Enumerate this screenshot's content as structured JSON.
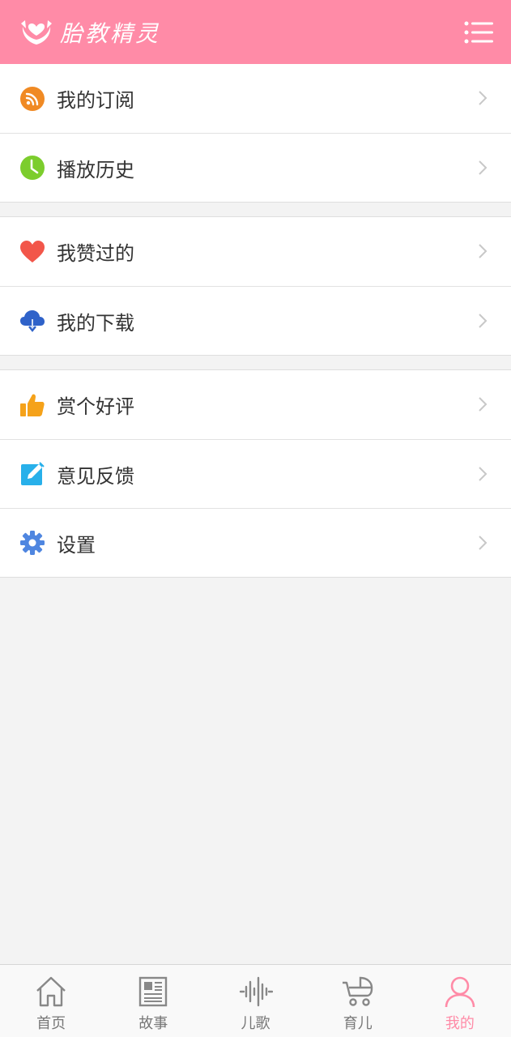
{
  "header": {
    "title": "胎教精灵",
    "logo_icon": "hands-heart-icon",
    "menu_icon": "list-menu-icon"
  },
  "groups": [
    {
      "items": [
        {
          "label": "我的订阅",
          "icon": "rss-icon",
          "color": "#f08a24"
        },
        {
          "label": "播放历史",
          "icon": "clock-icon",
          "color": "#7ccd2d"
        }
      ]
    },
    {
      "items": [
        {
          "label": "我赞过的",
          "icon": "heart-icon",
          "color": "#f2564a"
        },
        {
          "label": "我的下载",
          "icon": "cloud-download-icon",
          "color": "#2f62c9"
        }
      ]
    },
    {
      "items": [
        {
          "label": "赏个好评",
          "icon": "thumbs-up-icon",
          "color": "#f5a21a"
        },
        {
          "label": "意见反馈",
          "icon": "edit-icon",
          "color": "#28b0ea"
        },
        {
          "label": "设置",
          "icon": "gear-icon",
          "color": "#4f86e0"
        }
      ]
    }
  ],
  "tabbar": {
    "tabs": [
      {
        "label": "首页",
        "icon": "home-icon"
      },
      {
        "label": "故事",
        "icon": "newspaper-icon"
      },
      {
        "label": "儿歌",
        "icon": "sound-wave-icon"
      },
      {
        "label": "育儿",
        "icon": "stroller-icon"
      },
      {
        "label": "我的",
        "icon": "person-icon",
        "active": true
      }
    ],
    "active_color": "#ff8ba7",
    "inactive_color": "#777777"
  },
  "colors": {
    "header": "#ff8ba7",
    "background": "#f3f3f3"
  }
}
